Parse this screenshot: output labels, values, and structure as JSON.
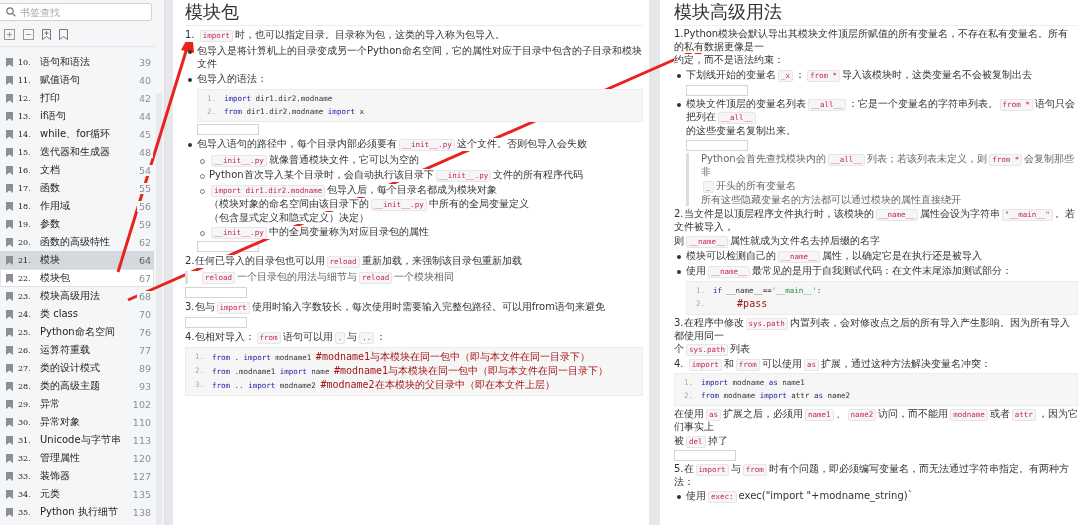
{
  "sidebar": {
    "search": {
      "placeholder": "书签查找"
    },
    "items": [
      {
        "num": "10.",
        "title": "语句和语法",
        "page": "39",
        "selected": false,
        "hovered": false
      },
      {
        "num": "11.",
        "title": "赋值语句",
        "page": "40",
        "selected": false,
        "hovered": false
      },
      {
        "num": "12.",
        "title": "打印",
        "page": "42",
        "selected": false,
        "hovered": false
      },
      {
        "num": "13.",
        "title": "if语句",
        "page": "44",
        "selected": false,
        "hovered": false
      },
      {
        "num": "14.",
        "title": "while、for循环",
        "page": "45",
        "selected": false,
        "hovered": false
      },
      {
        "num": "15.",
        "title": "迭代器和生成器",
        "page": "48",
        "selected": false,
        "hovered": false
      },
      {
        "num": "16.",
        "title": "文档",
        "page": "54",
        "selected": false,
        "hovered": false
      },
      {
        "num": "17.",
        "title": "函数",
        "page": "55",
        "selected": false,
        "hovered": false
      },
      {
        "num": "18.",
        "title": "作用域",
        "page": "56",
        "selected": false,
        "hovered": false
      },
      {
        "num": "19.",
        "title": "参数",
        "page": "59",
        "selected": false,
        "hovered": false
      },
      {
        "num": "20.",
        "title": "函数的高级特性",
        "page": "62",
        "selected": false,
        "hovered": false
      },
      {
        "num": "21.",
        "title": "模块",
        "page": "64",
        "selected": true,
        "hovered": false
      },
      {
        "num": "22.",
        "title": "模块包",
        "page": "67",
        "selected": false,
        "hovered": true
      },
      {
        "num": "23.",
        "title": "模块高级用法",
        "page": "68",
        "selected": false,
        "hovered": false
      },
      {
        "num": "24.",
        "title": "类 class",
        "page": "70",
        "selected": false,
        "hovered": false
      },
      {
        "num": "25.",
        "title": "Python命名空间",
        "page": "76",
        "selected": false,
        "hovered": false
      },
      {
        "num": "26.",
        "title": "运算符重载",
        "page": "77",
        "selected": false,
        "hovered": false
      },
      {
        "num": "27.",
        "title": "类的设计模式",
        "page": "89",
        "selected": false,
        "hovered": false
      },
      {
        "num": "28.",
        "title": "类的高级主题",
        "page": "93",
        "selected": false,
        "hovered": false
      },
      {
        "num": "29.",
        "title": "异常",
        "page": "102",
        "selected": false,
        "hovered": false
      },
      {
        "num": "30.",
        "title": "异常对象",
        "page": "110",
        "selected": false,
        "hovered": false
      },
      {
        "num": "31.",
        "title": "Unicode与字节串",
        "page": "113",
        "selected": false,
        "hovered": false
      },
      {
        "num": "32.",
        "title": "管理属性",
        "page": "120",
        "selected": false,
        "hovered": false
      },
      {
        "num": "33.",
        "title": "装饰器",
        "page": "127",
        "selected": false,
        "hovered": false
      },
      {
        "num": "34.",
        "title": "元类",
        "page": "135",
        "selected": false,
        "hovered": false
      },
      {
        "num": "35.",
        "title": "Python 执行细节",
        "page": "138",
        "selected": false,
        "hovered": false
      }
    ]
  },
  "pages": [
    {
      "blocks": [
        {
          "kind": "h1",
          "text": "模块包"
        },
        {
          "kind": "para",
          "lines": [
            [
              {
                "kind": "text",
                "text": "1. "
              },
              {
                "kind": "code",
                "text": "import"
              },
              {
                "kind": "text",
                "text": "时，也可以指定目录。目录称为包，这类的导入称为包导入。"
              }
            ]
          ]
        },
        {
          "kind": "bullet",
          "lines": [
            [
              {
                "kind": "text",
                "text": "包导入是将计算机上的目录变成另一个Python命名空间，它的属性对应于目录中包含的子目录和模块文件"
              }
            ]
          ]
        },
        {
          "kind": "bullet",
          "lines": [
            [
              {
                "kind": "text",
                "text": "包导入的语法："
              }
            ]
          ],
          "children": [
            {
              "kind": "codeblock",
              "lines": [
                {
                  "no": "1.",
                  "tokens": [
                    {
                      "kind": "kw",
                      "text": "import"
                    },
                    {
                      "kind": "plain",
                      "text": " dir1.dir2.modname"
                    }
                  ]
                },
                {
                  "no": "2.",
                  "tokens": [
                    {
                      "kind": "kw",
                      "text": "from"
                    },
                    {
                      "kind": "plain",
                      "text": " dir1.dir2.modname "
                    },
                    {
                      "kind": "kw",
                      "text": "import"
                    },
                    {
                      "kind": "plain",
                      "text": " x"
                    }
                  ]
                }
              ]
            },
            {
              "kind": "image"
            }
          ]
        },
        {
          "kind": "bullet",
          "lines": [
            [
              {
                "kind": "text",
                "text": "包导入语句的路径中，每个目录内部必须要有"
              },
              {
                "kind": "code",
                "text": "__init__.py"
              },
              {
                "kind": "text",
                "text": "这个文件。否则包导入会失败"
              }
            ]
          ],
          "children": [
            {
              "kind": "bullet",
              "lines": [
                [
                  {
                    "kind": "code",
                    "text": "__init__.py"
                  },
                  {
                    "kind": "text",
                    "text": "就像普通模块文件，它可以为空的"
                  }
                ]
              ]
            },
            {
              "kind": "bullet",
              "lines": [
                [
                  {
                    "kind": "text",
                    "text": "Python首次导入某个目录时，会自动执行该目录下"
                  },
                  {
                    "kind": "code",
                    "text": "__init__.py"
                  },
                  {
                    "kind": "text",
                    "text": "文件的所有程序代码"
                  }
                ]
              ]
            },
            {
              "kind": "bullet",
              "lines": [
                [
                  {
                    "kind": "code",
                    "text": "import dir1.dir2.modname"
                  },
                  {
                    "kind": "text",
                    "text": "包导入后，每个目录名都成为模块对象"
                  }
                ],
                [
                  {
                    "kind": "text",
                    "text": "（模块对象的命名空间由该目录下的"
                  },
                  {
                    "kind": "code",
                    "text": "__init__.py"
                  },
                  {
                    "kind": "text",
                    "text": "中所有的全局变量定义"
                  }
                ],
                [
                  {
                    "kind": "text",
                    "text": "（包含显式定义和隐式定义）决定）"
                  }
                ]
              ]
            },
            {
              "kind": "bullet",
              "lines": [
                [
                  {
                    "kind": "code",
                    "text": "__init__.py"
                  },
                  {
                    "kind": "text",
                    "text": "中的全局变量称为对应目录包的属性"
                  }
                ]
              ]
            },
            {
              "kind": "image"
            }
          ]
        },
        {
          "kind": "para",
          "lines": [
            [
              {
                "kind": "text",
                "text": "2.任何已导入的目录包也可以用"
              },
              {
                "kind": "code",
                "text": "reload"
              },
              {
                "kind": "text",
                "text": "重新加载，来强制该目录包重新加载"
              }
            ]
          ]
        },
        {
          "kind": "quote",
          "lines": [
            [
              {
                "kind": "code",
                "text": "reload"
              },
              {
                "kind": "text",
                "text": "一个目录包的用法与细节与"
              },
              {
                "kind": "code",
                "text": "reload"
              },
              {
                "kind": "text",
                "text": "一个模块相同"
              }
            ]
          ]
        },
        {
          "kind": "image"
        },
        {
          "kind": "para",
          "lines": [
            [
              {
                "kind": "text",
                "text": "3.包与"
              },
              {
                "kind": "code",
                "text": "import"
              },
              {
                "kind": "text",
                "text": "使用时输入字数较长，每次使用时需要输入完整包路径。可以用from语句来避免"
              }
            ]
          ]
        },
        {
          "kind": "image"
        },
        {
          "kind": "para",
          "lines": [
            [
              {
                "kind": "text",
                "text": "4.包相对导入："
              },
              {
                "kind": "code",
                "text": "from"
              },
              {
                "kind": "text",
                "text": "语句可以用"
              },
              {
                "kind": "code",
                "text": "."
              },
              {
                "kind": "text",
                "text": "与"
              },
              {
                "kind": "code",
                "text": ".."
              },
              {
                "kind": "text",
                "text": "："
              }
            ]
          ]
        },
        {
          "kind": "codeblock",
          "lines": [
            {
              "no": "1.",
              "tokens": [
                {
                  "kind": "kw",
                  "text": "from"
                },
                {
                  "kind": "plain",
                  "text": " . "
                },
                {
                  "kind": "kw",
                  "text": "import"
                },
                {
                  "kind": "plain",
                  "text": " modname1 "
                },
                {
                  "kind": "comment",
                  "text": "#modname1与本模块在同一包中（即与本文件在同一目录下）"
                }
              ]
            },
            {
              "no": "2.",
              "tokens": [
                {
                  "kind": "kw",
                  "text": "from"
                },
                {
                  "kind": "plain",
                  "text": " .modname1 "
                },
                {
                  "kind": "kw",
                  "text": "import"
                },
                {
                  "kind": "plain",
                  "text": " name "
                },
                {
                  "kind": "comment",
                  "text": "#modname1与本模块在同一包中（即与本文件在同一目录下）"
                }
              ]
            },
            {
              "no": "3.",
              "tokens": [
                {
                  "kind": "kw",
                  "text": "from"
                },
                {
                  "kind": "plain",
                  "text": " .. "
                },
                {
                  "kind": "kw",
                  "text": "import"
                },
                {
                  "kind": "plain",
                  "text": " modname2 "
                },
                {
                  "kind": "comment",
                  "text": "#modname2在本模块的父目录中（即在本文件上层）"
                }
              ]
            }
          ]
        }
      ]
    },
    {
      "blocks": [
        {
          "kind": "h1",
          "text": "模块高级用法"
        },
        {
          "kind": "para",
          "lines": [
            [
              {
                "kind": "text",
                "text": "1.Python模块会默认导出其模块文件顶层所赋值的所有变量名，不存在私有变量名。所有的私有数据更像是一"
              }
            ],
            [
              {
                "kind": "text",
                "text": "约定，而不是语法约束："
              }
            ]
          ]
        },
        {
          "kind": "bullet",
          "lines": [
            [
              {
                "kind": "text",
                "text": "下划线开始的变量名"
              },
              {
                "kind": "code",
                "text": "_x"
              },
              {
                "kind": "text",
                "text": "："
              },
              {
                "kind": "code",
                "text": "from *"
              },
              {
                "kind": "text",
                "text": "导入该模块时，这类变量名不会被复制出去"
              }
            ]
          ],
          "children": [
            {
              "kind": "image"
            }
          ]
        },
        {
          "kind": "bullet",
          "lines": [
            [
              {
                "kind": "text",
                "text": "模块文件顶层的变量名列表"
              },
              {
                "kind": "code",
                "text": "__all__"
              },
              {
                "kind": "text",
                "text": "：它是一个变量名的字符串列表。"
              },
              {
                "kind": "code",
                "text": "from *"
              },
              {
                "kind": "text",
                "text": "语句只会把列在"
              },
              {
                "kind": "code",
                "text": "__all__"
              }
            ],
            [
              {
                "kind": "text",
                "text": "的这些变量名复制出来。"
              }
            ]
          ],
          "children": [
            {
              "kind": "image"
            },
            {
              "kind": "quote",
              "lines": [
                [
                  {
                    "kind": "text",
                    "text": "Python会首先查找模块内的"
                  },
                  {
                    "kind": "code",
                    "text": "__all__"
                  },
                  {
                    "kind": "text",
                    "text": "列表；若该列表未定义，则"
                  },
                  {
                    "kind": "code",
                    "text": "from *"
                  },
                  {
                    "kind": "text",
                    "text": "会复制那些非"
                  }
                ],
                [
                  {
                    "kind": "code",
                    "text": "_"
                  },
                  {
                    "kind": "text",
                    "text": "开头的所有变量名"
                  }
                ],
                [
                  {
                    "kind": "text",
                    "text": "所有这些隐藏变量名的方法都可以通过模块的属性直接绕开"
                  }
                ]
              ]
            }
          ]
        },
        {
          "kind": "para",
          "lines": [
            [
              {
                "kind": "text",
                "text": "2.当文件是以顶层程序文件执行时，该模块的"
              },
              {
                "kind": "code",
                "text": "__name__"
              },
              {
                "kind": "text",
                "text": "属性会设为字符串"
              },
              {
                "kind": "code",
                "text": "\"__main__\""
              },
              {
                "kind": "text",
                "text": "。若文件被导入，"
              }
            ],
            [
              {
                "kind": "text",
                "text": "则"
              },
              {
                "kind": "code",
                "text": "__name__"
              },
              {
                "kind": "text",
                "text": "属性就成为文件名去掉后缀的名字"
              }
            ]
          ]
        },
        {
          "kind": "bullet",
          "lines": [
            [
              {
                "kind": "text",
                "text": "模块可以检测自己的"
              },
              {
                "kind": "code",
                "text": "__name__"
              },
              {
                "kind": "text",
                "text": "属性，以确定它是在执行还是被导入"
              }
            ]
          ]
        },
        {
          "kind": "bullet",
          "lines": [
            [
              {
                "kind": "text",
                "text": "使用"
              },
              {
                "kind": "code",
                "text": "__name__"
              },
              {
                "kind": "text",
                "text": "最常见的是用于自我测试代码：在文件末尾添加测试部分："
              }
            ]
          ],
          "children": [
            {
              "kind": "codeblock",
              "lines": [
                {
                  "no": "1.",
                  "tokens": [
                    {
                      "kind": "kw",
                      "text": "if"
                    },
                    {
                      "kind": "plain",
                      "text": " __name__=="
                    },
                    {
                      "kind": "str",
                      "text": "'__main__'"
                    },
                    {
                      "kind": "plain",
                      "text": ":"
                    }
                  ]
                },
                {
                  "no": "2.",
                  "tokens": [
                    {
                      "kind": "comment",
                      "text": "    #pass"
                    }
                  ]
                }
              ]
            }
          ]
        },
        {
          "kind": "para",
          "lines": [
            [
              {
                "kind": "text",
                "text": "3.在程序中修改"
              },
              {
                "kind": "code",
                "text": "sys.path"
              },
              {
                "kind": "text",
                "text": "内置列表，会对修改点之后的所有导入产生影响。因为所有导入都使用同一"
              }
            ],
            [
              {
                "kind": "text",
                "text": "个"
              },
              {
                "kind": "code",
                "text": "sys.path"
              },
              {
                "kind": "text",
                "text": "列表"
              }
            ]
          ]
        },
        {
          "kind": "para",
          "lines": [
            [
              {
                "kind": "text",
                "text": "4. "
              },
              {
                "kind": "code",
                "text": "import"
              },
              {
                "kind": "text",
                "text": "和"
              },
              {
                "kind": "code",
                "text": "from"
              },
              {
                "kind": "text",
                "text": "可以使用"
              },
              {
                "kind": "code",
                "text": "as"
              },
              {
                "kind": "text",
                "text": "扩展，通过这种方法解决变量名冲突："
              }
            ]
          ]
        },
        {
          "kind": "codeblock",
          "lines": [
            {
              "no": "1.",
              "tokens": [
                {
                  "kind": "kw",
                  "text": "import"
                },
                {
                  "kind": "plain",
                  "text": " modname "
                },
                {
                  "kind": "kw",
                  "text": "as"
                },
                {
                  "kind": "plain",
                  "text": " name1"
                }
              ]
            },
            {
              "no": "2.",
              "tokens": [
                {
                  "kind": "kw",
                  "text": "from"
                },
                {
                  "kind": "plain",
                  "text": " modname "
                },
                {
                  "kind": "kw",
                  "text": "import"
                },
                {
                  "kind": "plain",
                  "text": " attr "
                },
                {
                  "kind": "kw",
                  "text": "as"
                },
                {
                  "kind": "plain",
                  "text": " name2"
                }
              ]
            }
          ]
        },
        {
          "kind": "para",
          "lines": [
            [
              {
                "kind": "text",
                "text": "在使用"
              },
              {
                "kind": "code",
                "text": "as"
              },
              {
                "kind": "text",
                "text": "扩展之后，必须用"
              },
              {
                "kind": "code",
                "text": "name1"
              },
              {
                "kind": "text",
                "text": "、"
              },
              {
                "kind": "code",
                "text": "name2"
              },
              {
                "kind": "text",
                "text": "访问，而不能用"
              },
              {
                "kind": "code",
                "text": "modname"
              },
              {
                "kind": "text",
                "text": "或者"
              },
              {
                "kind": "code",
                "text": "attr"
              },
              {
                "kind": "text",
                "text": "，因为它们事实上"
              }
            ],
            [
              {
                "kind": "text",
                "text": "被"
              },
              {
                "kind": "code",
                "text": "del"
              },
              {
                "kind": "text",
                "text": "掉了"
              }
            ]
          ]
        },
        {
          "kind": "image"
        },
        {
          "kind": "para",
          "lines": [
            [
              {
                "kind": "text",
                "text": "5.在"
              },
              {
                "kind": "code",
                "text": "import"
              },
              {
                "kind": "text",
                "text": "与"
              },
              {
                "kind": "code",
                "text": "from"
              },
              {
                "kind": "text",
                "text": "时有个问题，即必须编写变量名，而无法通过字符串指定。有两种方法："
              }
            ]
          ]
        },
        {
          "kind": "bullet",
          "lines": [
            [
              {
                "kind": "text",
                "text": "使用"
              },
              {
                "kind": "code",
                "text": "exec:"
              },
              {
                "kind": "text",
                "text": "exec(\"import \"+modname_string)`"
              }
            ]
          ]
        }
      ]
    }
  ]
}
